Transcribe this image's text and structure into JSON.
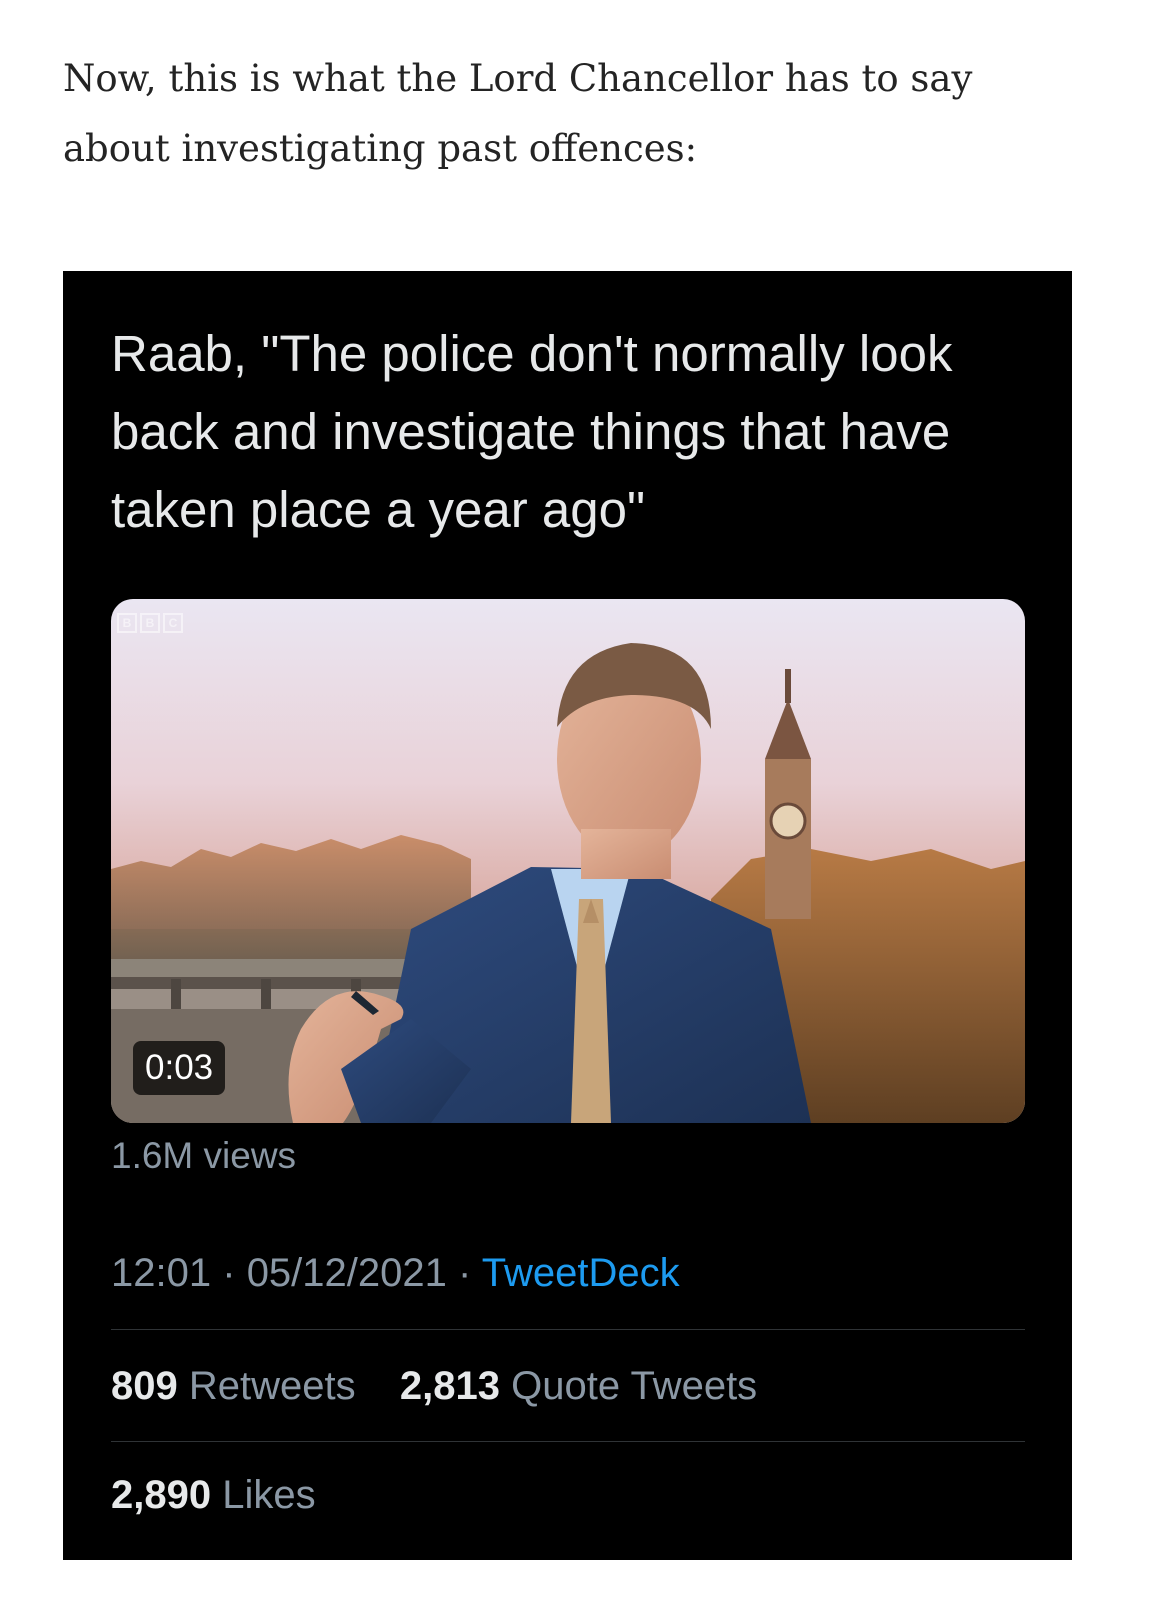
{
  "article": {
    "intro_text": "Now, this is what the Lord Chancellor has to say about investigating past offences:"
  },
  "tweet": {
    "text": "Raab, \"The police don't normally look back and investigate things that have taken place a year ago\"",
    "video": {
      "duration": "0:03",
      "broadcaster_logo": [
        "B",
        "B",
        "C"
      ]
    },
    "views": "1.6M views",
    "time": "12:01",
    "date": "05/12/2021",
    "separator": "·",
    "source": "TweetDeck",
    "retweets": {
      "count": "809",
      "label": "Retweets"
    },
    "quote_tweets": {
      "count": "2,813",
      "label": "Quote Tweets"
    },
    "likes": {
      "count": "2,890",
      "label": "Likes"
    }
  },
  "colors": {
    "page_background": "#ffffff",
    "article_text": "#242424",
    "card_background": "#000000",
    "tweet_text": "#e7e9ea",
    "secondary_text": "#8b98a5",
    "link": "#1d9bf0",
    "divider": "#2f3336"
  }
}
